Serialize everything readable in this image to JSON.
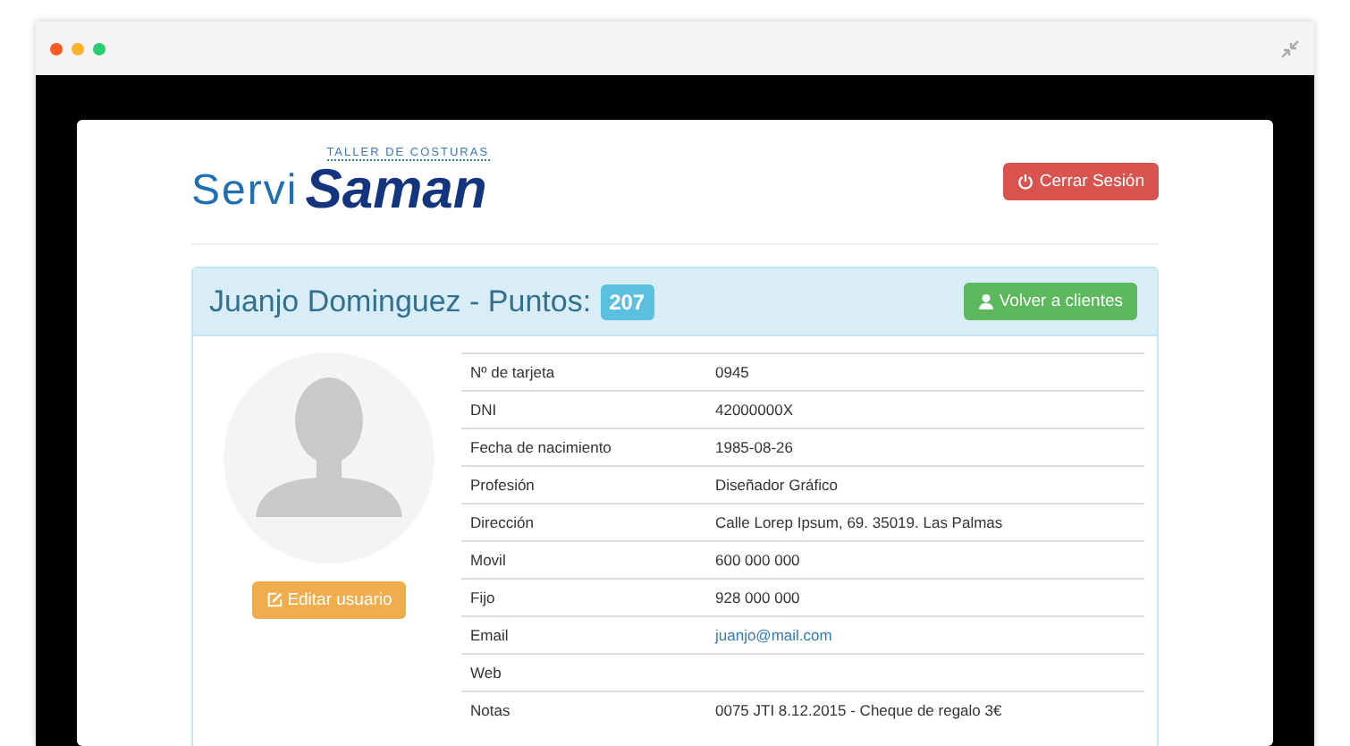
{
  "logo": {
    "prefix": "Servi",
    "name": "Saman",
    "tagline": "TALLER DE COSTURAS"
  },
  "logout_button": {
    "label": "Cerrar Sesión"
  },
  "panel": {
    "title": "Juanjo Dominguez - Puntos:",
    "points": "207",
    "back_button": "Volver a clientes"
  },
  "edit_button": {
    "label": "Editar usuario"
  },
  "details": [
    {
      "label": "Nº de tarjeta",
      "value": "0945",
      "kind": "text"
    },
    {
      "label": "DNI",
      "value": "42000000X",
      "kind": "text"
    },
    {
      "label": "Fecha de nacimiento",
      "value": "1985-08-26",
      "kind": "text"
    },
    {
      "label": "Profesión",
      "value": "Diseñador Gráfico",
      "kind": "text"
    },
    {
      "label": "Dirección",
      "value": "Calle Lorep Ipsum, 69. 35019. Las Palmas",
      "kind": "text"
    },
    {
      "label": "Movil",
      "value": "600 000 000",
      "kind": "text"
    },
    {
      "label": "Fijo",
      "value": "928 000 000",
      "kind": "text"
    },
    {
      "label": "Email",
      "value": "juanjo@mail.com",
      "kind": "link"
    },
    {
      "label": "Web"
    },
    {
      "label": "Notas",
      "value": "0075 JTI 8.12.2015 - Cheque de regalo 3€",
      "kind": "text"
    }
  ]
}
